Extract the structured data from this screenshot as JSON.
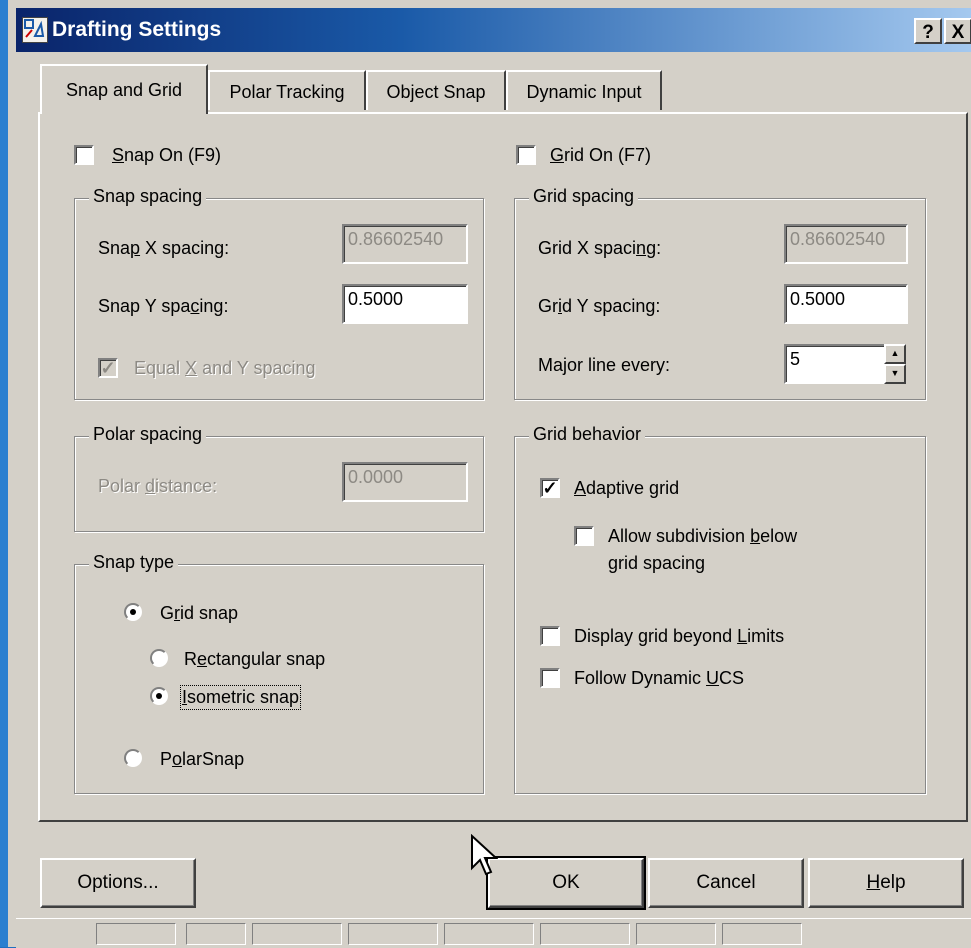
{
  "window": {
    "title": "Drafting Settings",
    "help_button": "?",
    "close_button": "X"
  },
  "tabs": [
    {
      "label": "Snap and Grid",
      "active": true
    },
    {
      "label": "Polar Tracking",
      "active": false
    },
    {
      "label": "Object Snap",
      "active": false
    },
    {
      "label": "Dynamic Input",
      "active": false
    }
  ],
  "snap": {
    "on_label_pre": "",
    "on_label_u": "S",
    "on_label_post": "nap On (F9)",
    "on_checked": false,
    "spacing": {
      "legend": "Snap spacing",
      "x_label_pre": "Sna",
      "x_label_u": "p",
      "x_label_post": " X spacing:",
      "x_value": "0.86602540",
      "y_label_pre": "Snap Y spa",
      "y_label_u": "c",
      "y_label_post": "ing:",
      "y_value": "0.5000",
      "equal_pre": "Equal ",
      "equal_u": "X",
      "equal_post": " and Y spacing",
      "equal_checked": true
    },
    "polar": {
      "legend": "Polar spacing",
      "distance_pre": "Polar ",
      "distance_u": "d",
      "distance_post": "istance:",
      "distance_value": "0.0000"
    },
    "type": {
      "legend": "Snap type",
      "grid_pre": "G",
      "grid_u": "r",
      "grid_post": "id snap",
      "rect_pre": "R",
      "rect_u": "e",
      "rect_post": "ctangular snap",
      "iso_pre": "",
      "iso_u": "I",
      "iso_post": "sometric snap",
      "polar_pre": "P",
      "polar_u": "o",
      "polar_post": "larSnap"
    }
  },
  "grid": {
    "on_label_pre": "",
    "on_label_u": "G",
    "on_label_post": "rid On (F7)",
    "on_checked": false,
    "spacing": {
      "legend": "Grid spacing",
      "x_label_pre": "Grid X spaci",
      "x_label_u": "n",
      "x_label_post": "g:",
      "x_value": "0.86602540",
      "y_label_pre": "Gr",
      "y_label_u": "i",
      "y_label_post": "d Y spacing:",
      "y_value": "0.5000",
      "major_label": "Major line every:",
      "major_value": "5"
    },
    "behavior": {
      "legend": "Grid behavior",
      "adaptive_pre": "",
      "adaptive_u": "A",
      "adaptive_post": "daptive grid",
      "adaptive_checked": true,
      "subdiv_line1_pre": "Allow subdivision ",
      "subdiv_line1_u": "b",
      "subdiv_line1_post": "elow",
      "subdiv_line2": "grid spacing",
      "subdiv_checked": false,
      "beyond_pre": "Display grid beyond ",
      "beyond_u": "L",
      "beyond_post": "imits",
      "beyond_checked": false,
      "follow_pre": "Follow Dynamic ",
      "follow_u": "U",
      "follow_post": "CS",
      "follow_checked": false
    }
  },
  "buttons": {
    "options": "Options...",
    "ok": "OK",
    "cancel": "Cancel",
    "help_u": "H",
    "help_post": "elp"
  },
  "colors": {
    "title_start": "#0a246a",
    "title_end": "#a6caf0",
    "face": "#d4d0c8"
  }
}
